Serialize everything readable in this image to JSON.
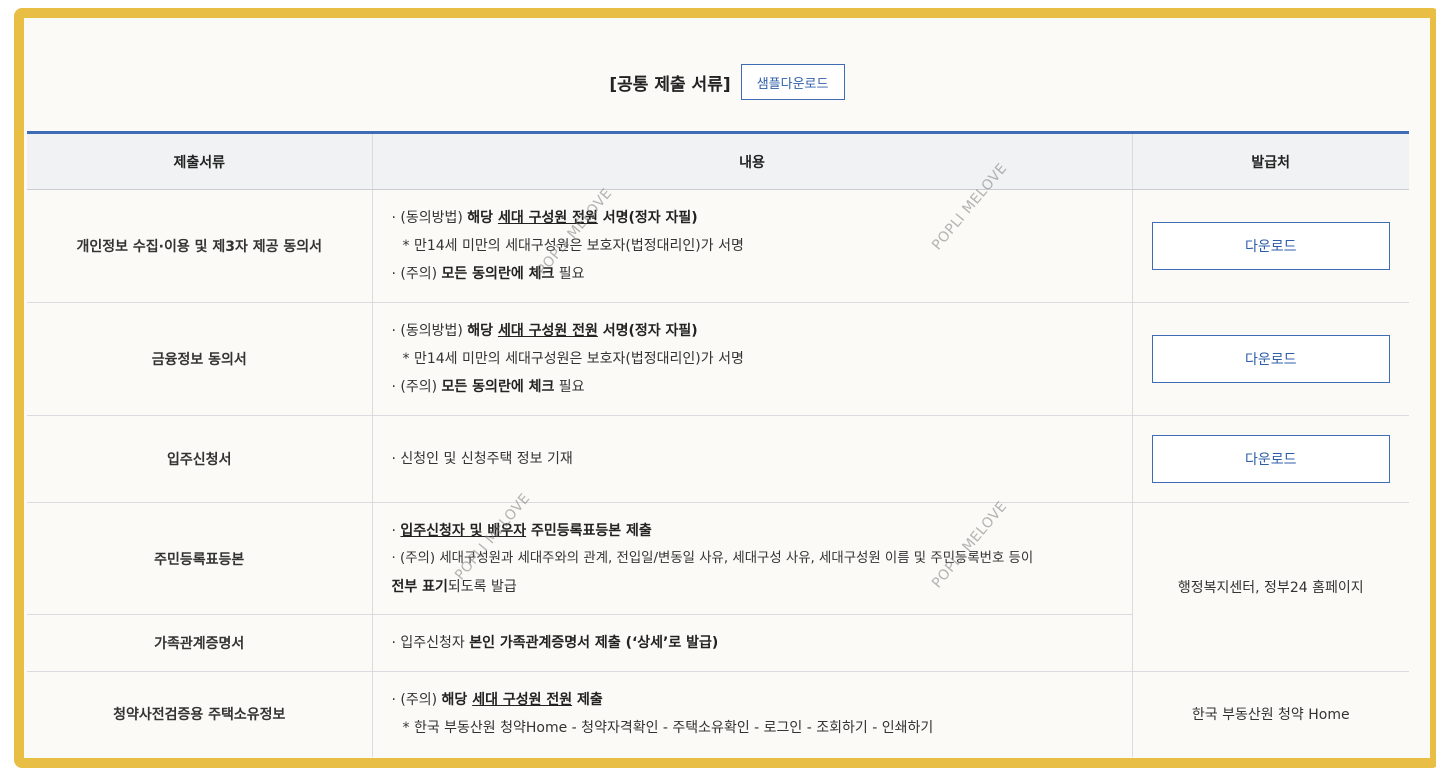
{
  "header": {
    "title": "[공통 제출 서류]",
    "sample_button": "샘플다운로드"
  },
  "table": {
    "headers": [
      "제출서류",
      "내용",
      "발급처"
    ],
    "rows": {
      "privacy": {
        "name": "개인정보 수집·이용 및 제3자 제공 동의서",
        "line1_prefix": "· (동의방법) ",
        "line1_bold": "해당 ",
        "line1_underline": "세대 구성원 전원",
        "line1_bold2": " 서명(정자 자필)",
        "line2": "* 만14세 미만의 세대구성원은 보호자(법정대리인)가 서명",
        "line3_prefix": "· (주의) ",
        "line3_bold": "모든 동의란에 체크",
        "line3_suffix": " 필요",
        "button": "다운로드"
      },
      "finance": {
        "name": "금융정보 동의서",
        "line1_prefix": "· (동의방법) ",
        "line1_bold": "해당 ",
        "line1_underline": "세대 구성원 전원",
        "line1_bold2": " 서명(정자 자필)",
        "line2": "* 만14세 미만의 세대구성원은 보호자(법정대리인)가 서명",
        "line3_prefix": "· (주의) ",
        "line3_bold": "모든 동의란에 체크",
        "line3_suffix": " 필요",
        "button": "다운로드"
      },
      "application": {
        "name": "입주신청서",
        "line1": "· 신청인 및 신청주택 정보 기재",
        "button": "다운로드"
      },
      "resident": {
        "name": "주민등록표등본",
        "line1_prefix": "· ",
        "line1_underline": "입주신청자 및 배우자",
        "line1_bold": " 주민등록표등본 제출",
        "line2": "· (주의) 세대구성원과 세대주와의 관계, 전입일/변동일 사유, 세대구성 사유, 세대구성원 이름 및 주민등록번호 등이",
        "line3_bold": "전부 표기",
        "line3_suffix": "되도록 발급"
      },
      "family": {
        "name": "가족관계증명서",
        "line1_prefix": "· 입주신청자 ",
        "line1_bold": "본인 가족관계증명서 제출 (‘상세’로 발급)"
      },
      "shared_issuer": "행정복지센터, 정부24 홈페이지",
      "housing": {
        "name": "청약사전검증용 주택소유정보",
        "line1_prefix": "· (주의) ",
        "line1_bold": "해당 ",
        "line1_underline": "세대 구성원 전원",
        "line1_bold2": " 제출",
        "line2": "* 한국 부동산원 청약Home - 청약자격확인 - 주택소유확인 - 로그인 - 조회하기 - 인쇄하기",
        "issuer": "한국 부동산원 청약 Home"
      }
    }
  },
  "watermark": "POPLI MELOVE",
  "colors": {
    "frame": "#E8BE45",
    "accent": "#3E6DB5",
    "header_bg": "#F1F2F3"
  }
}
